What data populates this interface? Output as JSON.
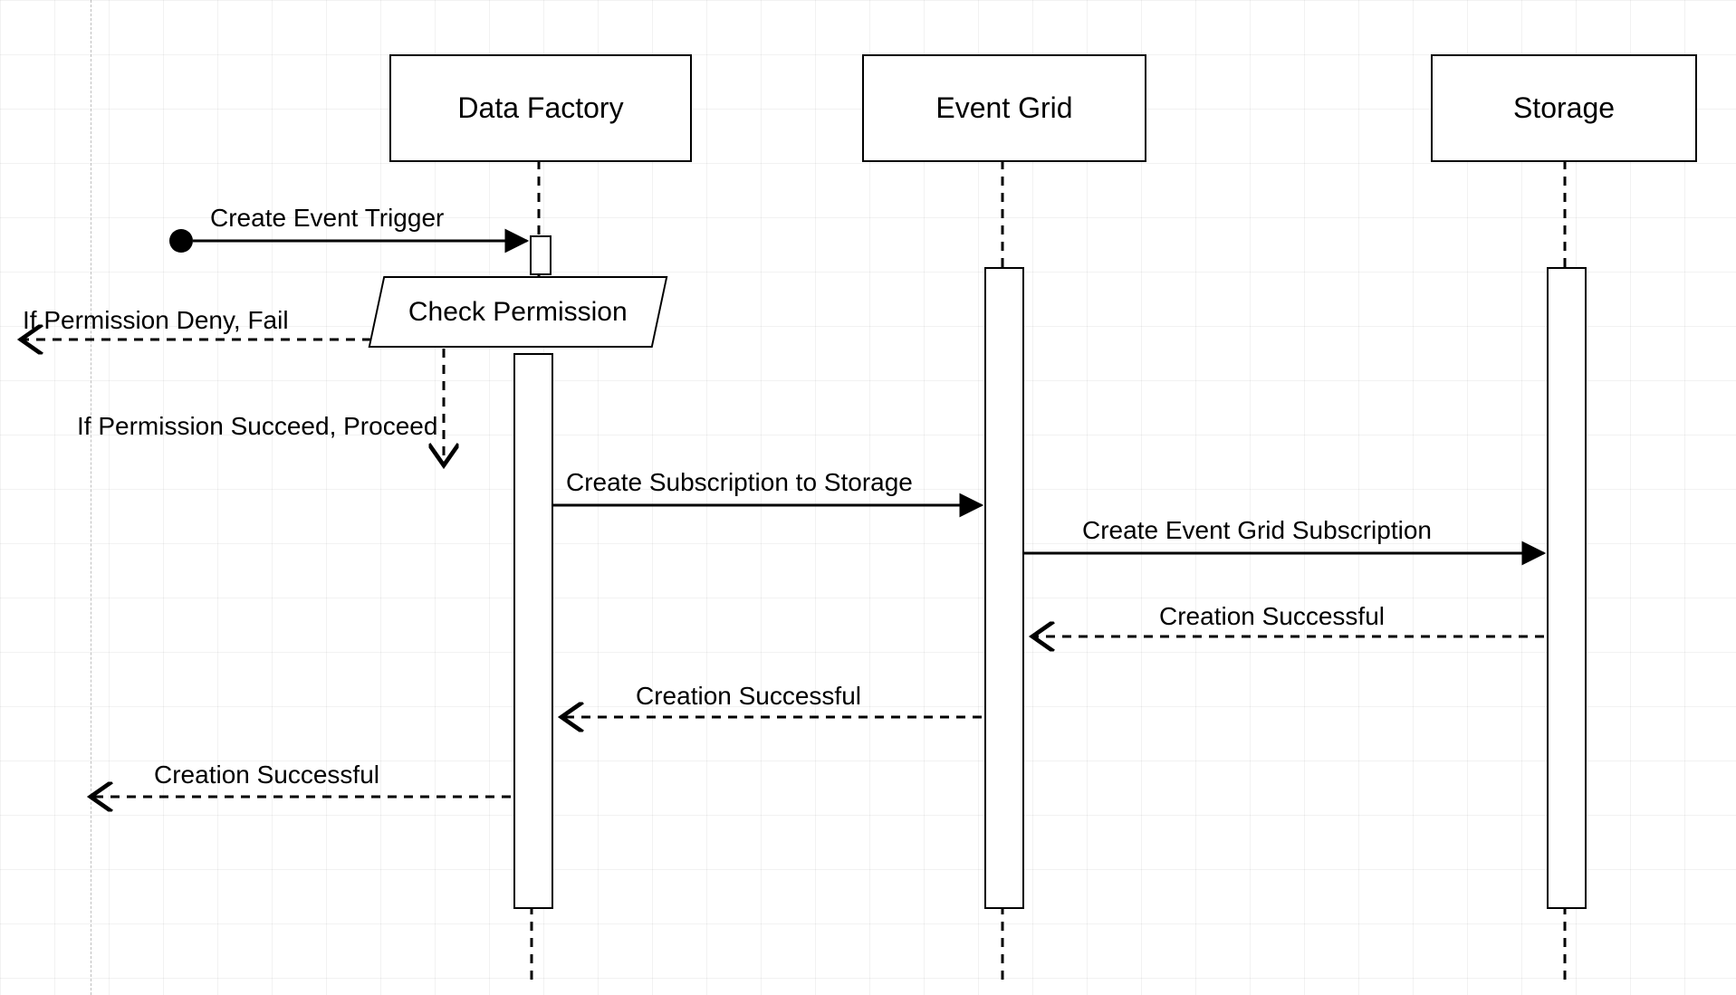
{
  "diagram": {
    "type": "sequence_diagram",
    "participants": {
      "data_factory": "Data Factory",
      "event_grid": "Event Grid",
      "storage": "Storage"
    },
    "initial_action": "Create Event Trigger",
    "decision": "Check Permission",
    "branches": {
      "deny": "If Permission Deny, Fail",
      "succeed": "If Permission Succeed, Proceed"
    },
    "messages": {
      "df_to_eg": "Create Subscription to Storage",
      "eg_to_storage": "Create Event Grid Subscription",
      "storage_to_eg_return": "Creation Successful",
      "eg_to_df_return": "Creation Successful",
      "df_to_actor_return": "Creation Successful"
    }
  }
}
